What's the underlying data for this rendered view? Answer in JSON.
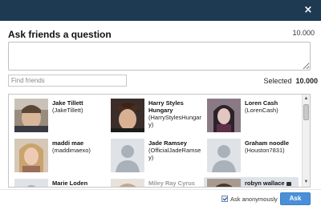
{
  "dialog": {
    "close_glyph": "×",
    "title": "Ask friends a question",
    "char_count": "10.000"
  },
  "search": {
    "placeholder": "Find friends"
  },
  "selection": {
    "label": "Selected",
    "count": "10.000"
  },
  "friends": [
    {
      "name": "Jake Tillett",
      "handle": "(JakeTillett)",
      "photo": "photo"
    },
    {
      "name": "Harry Styles Hungary",
      "handle": "(HarryStylesHungary)",
      "photo": "photo"
    },
    {
      "name": "Loren Cash",
      "handle": "(LorenCash)",
      "photo": "photo"
    },
    {
      "name": "maddi mae",
      "handle": "(maddimaexo)",
      "photo": "photo"
    },
    {
      "name": "Jade Ramsey",
      "handle": "(OfficialJadeRamsey)",
      "photo": "default-avatar"
    },
    {
      "name": "Graham noodle",
      "handle": "(Houston7831)",
      "photo": "default-avatar"
    },
    {
      "name": "Marie Loden",
      "handle": "",
      "photo": "default-avatar"
    },
    {
      "name": "Miley Ray Cyrus",
      "handle": "",
      "photo": "photo"
    },
    {
      "name": "robyn wallace",
      "handle": "",
      "photo": "photo"
    }
  ],
  "footer": {
    "anonymous_label": "Ask anonymously",
    "ask_label": "Ask"
  },
  "colors": {
    "titlebar": "#1d3a52",
    "ask_button": "#4a90d9",
    "highlight": "#dfe3ea"
  }
}
